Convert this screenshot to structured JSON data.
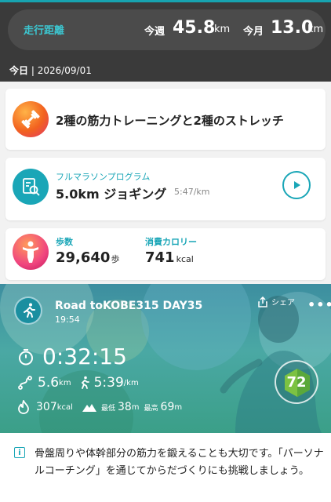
{
  "colors": {
    "accent": "#1aa6b7",
    "header_bg": "#3a3a3a",
    "workout_orange": "#f2621f",
    "steps_pink": "#f0457f"
  },
  "distance": {
    "label": "走行距離",
    "week_label": "今週",
    "week_value": "45.8",
    "week_unit": "km",
    "month_label": "今月",
    "month_value": "13.0",
    "month_unit": "km"
  },
  "date": {
    "today_label": "今日",
    "separator": " | ",
    "value": "2026/09/01"
  },
  "workout": {
    "icon": "dumbbell-icon",
    "text": "2種の筋力トレーニングと2種のストレッチ"
  },
  "program": {
    "icon": "plan-search-icon",
    "label": "フルマラソンプログラム",
    "main": "5.0km ジョギング",
    "pace": "5:47/km",
    "play_icon": "play-icon"
  },
  "stats": {
    "icon": "body-icon",
    "steps_label": "歩数",
    "steps_value": "29,640",
    "steps_unit": "歩",
    "cal_label": "消費カロリー",
    "cal_value": "741",
    "cal_unit": "kcal"
  },
  "activity": {
    "icon": "running-icon",
    "title": "Road toKOBE315 DAY35",
    "time": "19:54",
    "share_label": "シェア",
    "more": "•••",
    "duration": "0:32:15",
    "distance_value": "5.6",
    "distance_unit": "km",
    "pace_value": "5:39",
    "pace_unit": "/km",
    "calories_value": "307",
    "calories_unit": "kcal",
    "min_label": "最低",
    "min_value": "38",
    "min_unit": "m",
    "max_label": "最高",
    "max_value": "69",
    "max_unit": "m",
    "score": "72"
  },
  "tip": {
    "icon": "info-icon",
    "icon_glyph": "i",
    "text": "骨盤周りや体幹部分の筋力を鍛えることも大切です。「パーソナルコーチング」を通じてからだづくりにも挑戦しましょう。"
  }
}
